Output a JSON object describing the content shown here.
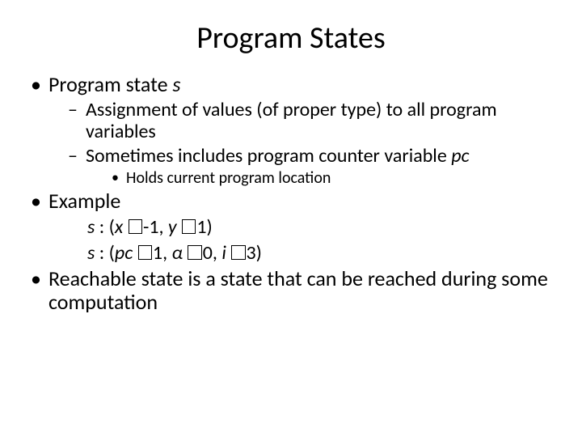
{
  "title": "Program States",
  "b1_prefix": "Program state ",
  "b1_var": "s",
  "b1a": "Assignment of values (of proper type) to all program variables",
  "b1b_prefix": "Sometimes includes program counter variable ",
  "b1b_var": "pc",
  "b1b1": "Holds current program location",
  "b2": "Example",
  "ex1_1": "s ",
  "ex1_2": ": (",
  "ex1_3": "x ",
  "ex1_4": "-1, ",
  "ex1_5": "y ",
  "ex1_6": "1)",
  "ex2_1": "s ",
  "ex2_2": ": (",
  "ex2_3": "pc ",
  "ex2_4": "1, ",
  "ex2_5": "α ",
  "ex2_6": "0, ",
  "ex2_7": "i ",
  "ex2_8": "3)",
  "b3_prefix": "Reachable state ",
  "b3_rest": "is a state that can be reached during some computation"
}
